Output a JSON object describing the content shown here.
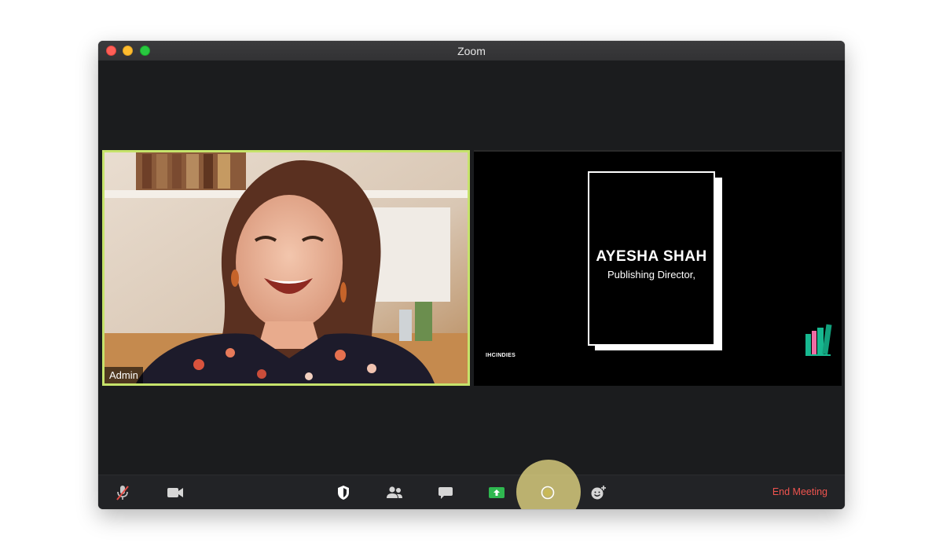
{
  "window": {
    "title": "Zoom"
  },
  "participants": [
    {
      "name": "Admin",
      "speaking": true,
      "highlight_color": "#c6e36b"
    }
  ],
  "shared_screen": {
    "card_name": "AYESHA SHAH",
    "card_role": "Publishing Director,",
    "brand_text": "IHCINDIES"
  },
  "toolbar": {
    "buttons": [
      {
        "name": "mute",
        "icon": "microphone-muted-icon"
      },
      {
        "name": "video",
        "icon": "video-camera-icon"
      },
      {
        "name": "security",
        "icon": "shield-icon"
      },
      {
        "name": "participants",
        "icon": "people-icon"
      },
      {
        "name": "chat",
        "icon": "chat-bubble-icon"
      },
      {
        "name": "share-screen",
        "icon": "share-screen-icon",
        "color": "#2fb850"
      },
      {
        "name": "record",
        "icon": "record-icon",
        "highlighted": true
      },
      {
        "name": "reactions",
        "icon": "emoji-add-icon"
      }
    ],
    "end_meeting_label": "End Meeting",
    "end_meeting_color": "#f0544f"
  }
}
